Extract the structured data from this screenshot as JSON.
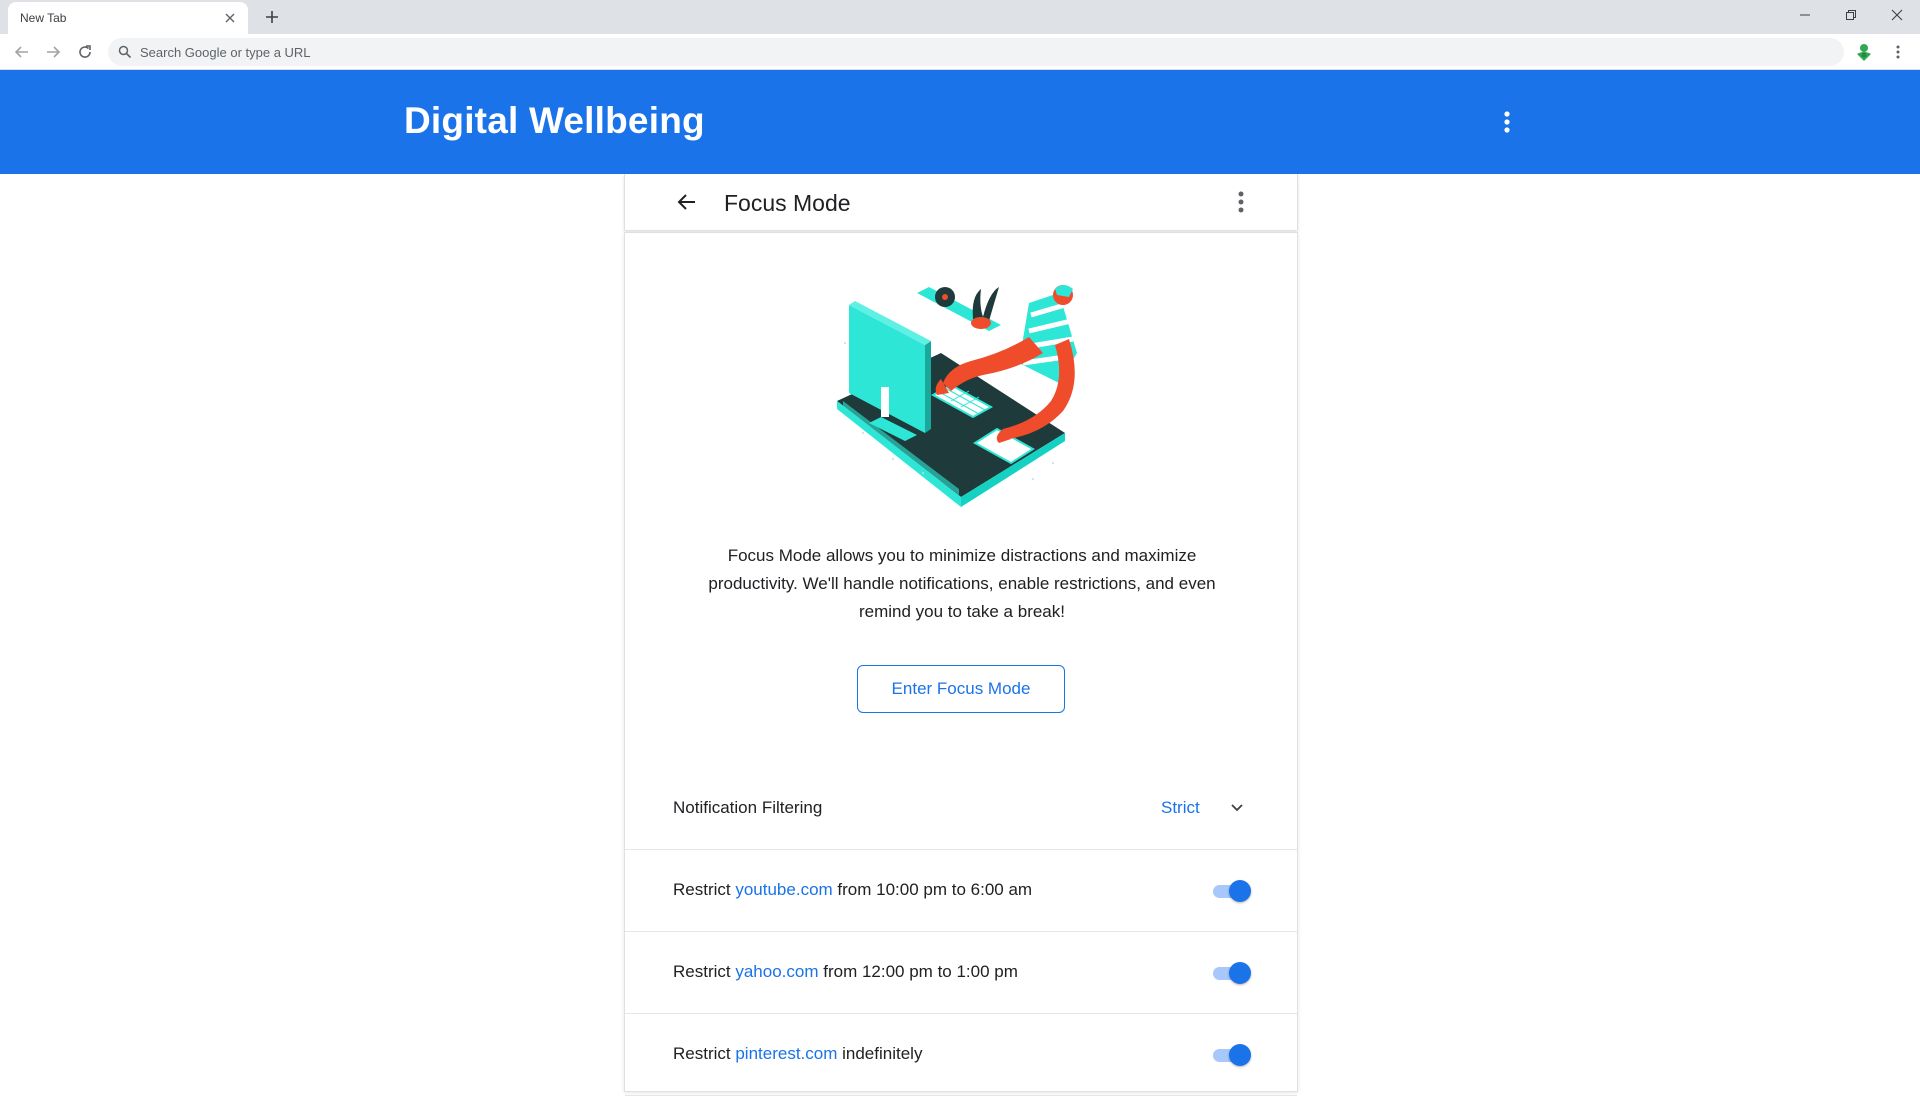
{
  "browser": {
    "tab_title": "New Tab",
    "omnibox_placeholder": "Search Google or type a URL"
  },
  "app": {
    "title": "Digital Wellbeing",
    "accent_color": "#1a73e8"
  },
  "page": {
    "title": "Focus Mode",
    "description": "Focus Mode allows you to minimize distractions and maximize productivity. We'll handle notifications, enable restrictions, and even remind you to take a break!",
    "enter_button": "Enter Focus Mode"
  },
  "settings": {
    "notification_filtering": {
      "label": "Notification Filtering",
      "value": "Strict"
    },
    "restrictions": [
      {
        "prefix": "Restrict ",
        "site": "youtube.com",
        "suffix": " from 10:00 pm to 6:00 am",
        "enabled": true
      },
      {
        "prefix": "Restrict ",
        "site": "yahoo.com",
        "suffix": " from 12:00 pm to 1:00 pm",
        "enabled": true
      },
      {
        "prefix": "Restrict ",
        "site": "pinterest.com",
        "suffix": " indefinitely",
        "enabled": true
      }
    ]
  },
  "icons": [
    "close-icon",
    "plus-icon",
    "minimize-icon",
    "restore-icon",
    "back-arrow-icon",
    "forward-arrow-icon",
    "reload-icon",
    "search-icon",
    "extension-icon",
    "more-vert-icon",
    "arrow-back-icon",
    "chevron-down-icon"
  ]
}
